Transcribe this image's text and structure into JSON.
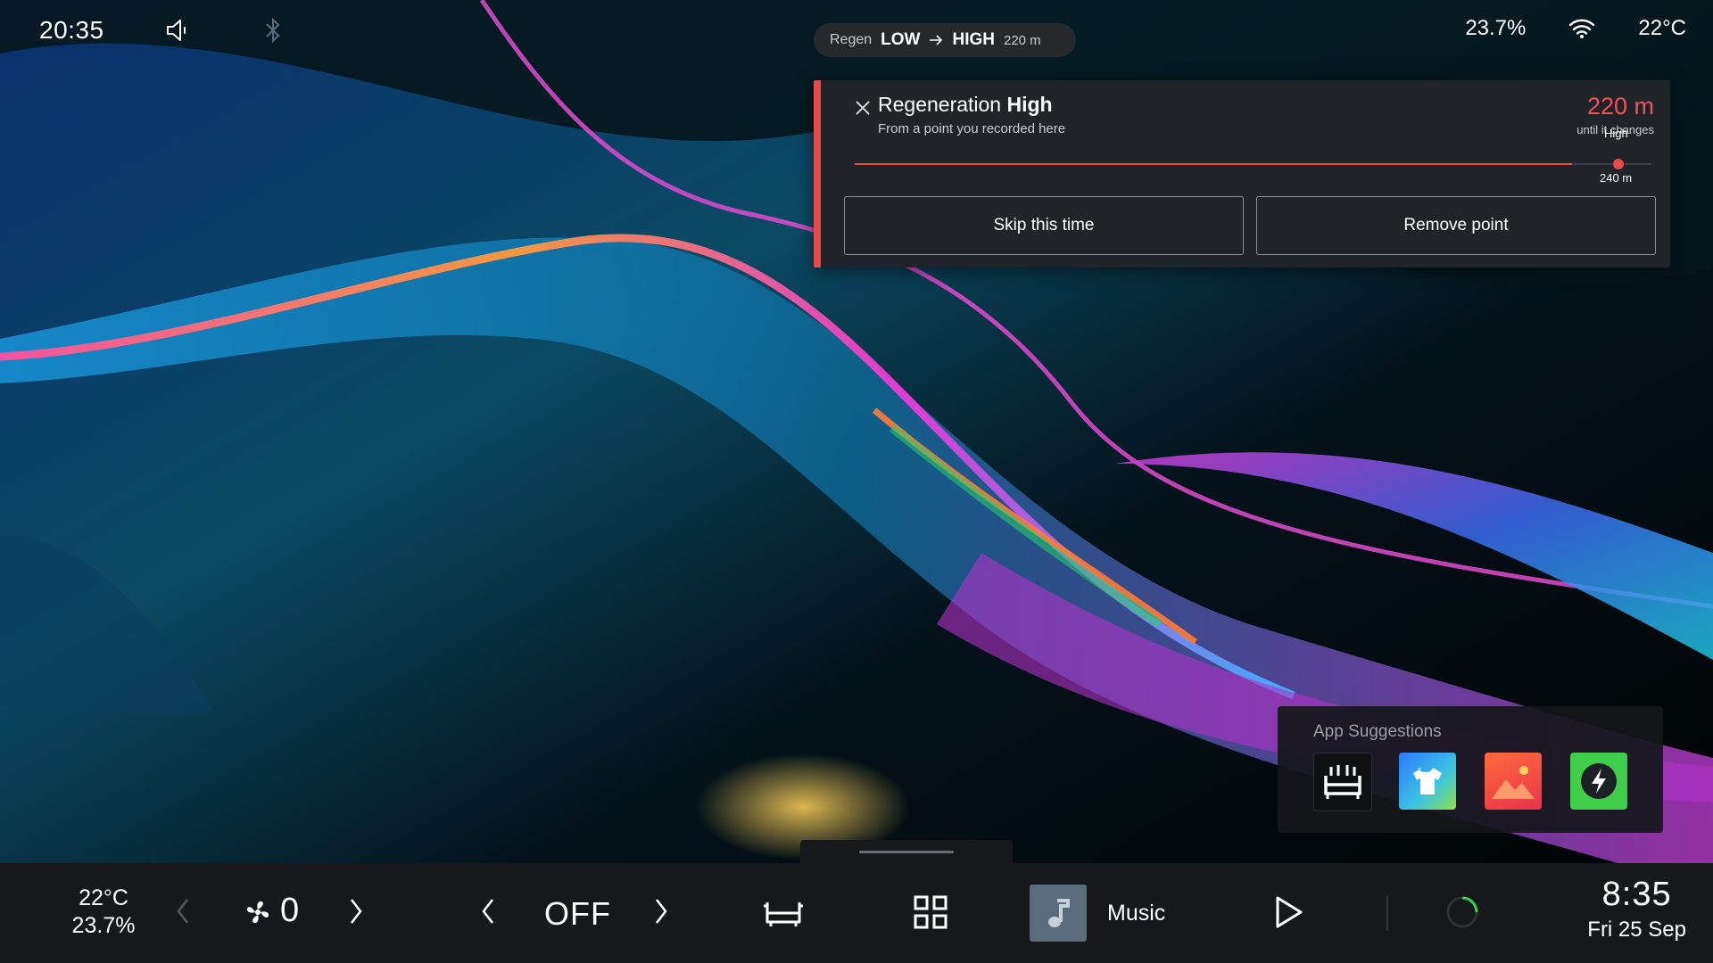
{
  "status_bar": {
    "time": "20:35",
    "humidity": "23.7%",
    "temperature": "22°C",
    "icons": [
      "speaker-muted-icon",
      "bluetooth-icon",
      "wifi-icon"
    ]
  },
  "regen_pill": {
    "label": "Regen",
    "from": "LOW",
    "to": "HIGH",
    "distance": "220 m"
  },
  "notification": {
    "title_prefix": "Regeneration",
    "title_bold": "High",
    "subtitle": "From a point you recorded here",
    "distance": "220 m",
    "distance_caption": "until it changes",
    "marker_label": "High",
    "marker_distance": "240 m",
    "progress": 0.9,
    "skip_label": "Skip this time",
    "remove_label": "Remove point",
    "accent_color": "#e8494a"
  },
  "app_suggestions": {
    "label": "App Suggestions",
    "apps": [
      "car-seat-app-icon",
      "shirt-app-icon",
      "photos-app-icon",
      "charging-app-icon"
    ]
  },
  "dock": {
    "cabin_temp": "22°C",
    "cabin_humidity": "23.7%",
    "fan_speed": "0",
    "climate_mode": "OFF",
    "music_label": "Music",
    "clock": "8:35",
    "date": "Fri 25 Sep"
  }
}
